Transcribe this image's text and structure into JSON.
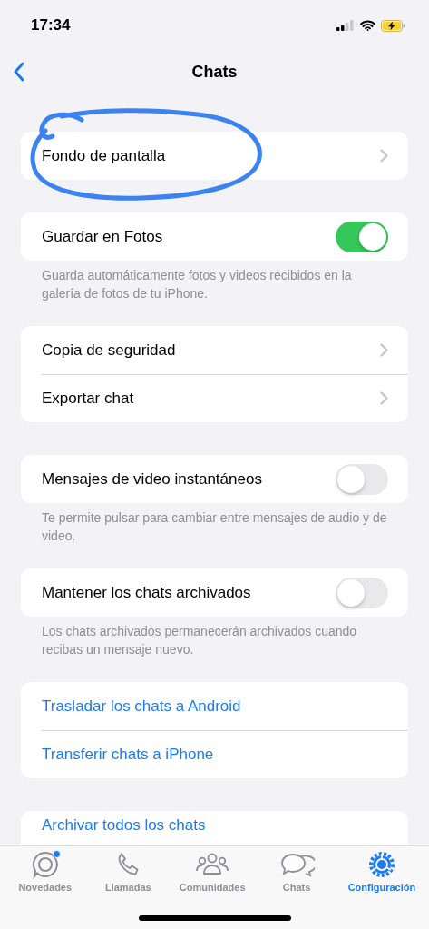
{
  "status_bar": {
    "time": "17:34"
  },
  "nav": {
    "title": "Chats"
  },
  "sections": [
    {
      "rows": [
        {
          "kind": "disclosure",
          "label": "Fondo de pantalla"
        }
      ]
    },
    {
      "rows": [
        {
          "kind": "toggle",
          "label": "Guardar en Fotos",
          "on": true
        }
      ],
      "footer": "Guarda automáticamente fotos y videos recibidos en la galería de fotos de tu iPhone."
    },
    {
      "rows": [
        {
          "kind": "disclosure",
          "label": "Copia de seguridad"
        },
        {
          "kind": "disclosure",
          "label": "Exportar chat"
        }
      ]
    },
    {
      "rows": [
        {
          "kind": "toggle",
          "label": "Mensajes de video instantáneos",
          "on": false
        }
      ],
      "footer": "Te permite pulsar para cambiar entre mensajes de audio y de video."
    },
    {
      "rows": [
        {
          "kind": "toggle",
          "label": "Mantener los chats archivados",
          "on": false
        }
      ],
      "footer": "Los chats archivados permanecerán archivados cuando recibas un mensaje nuevo."
    },
    {
      "rows": [
        {
          "kind": "action",
          "label": "Trasladar los chats a Android"
        },
        {
          "kind": "action",
          "label": "Transferir chats a iPhone"
        }
      ]
    },
    {
      "rows": [
        {
          "kind": "action",
          "label": "Archivar todos los chats"
        }
      ]
    }
  ],
  "tabs": [
    {
      "kind": "updates",
      "label": "Novedades",
      "selected": false,
      "badge": true
    },
    {
      "kind": "calls",
      "label": "Llamadas",
      "selected": false,
      "badge": false
    },
    {
      "kind": "communities",
      "label": "Comunidades",
      "selected": false,
      "badge": false
    },
    {
      "kind": "chats",
      "label": "Chats",
      "selected": false,
      "badge": false
    },
    {
      "kind": "settings",
      "label": "Configuración",
      "selected": true,
      "badge": false
    }
  ]
}
